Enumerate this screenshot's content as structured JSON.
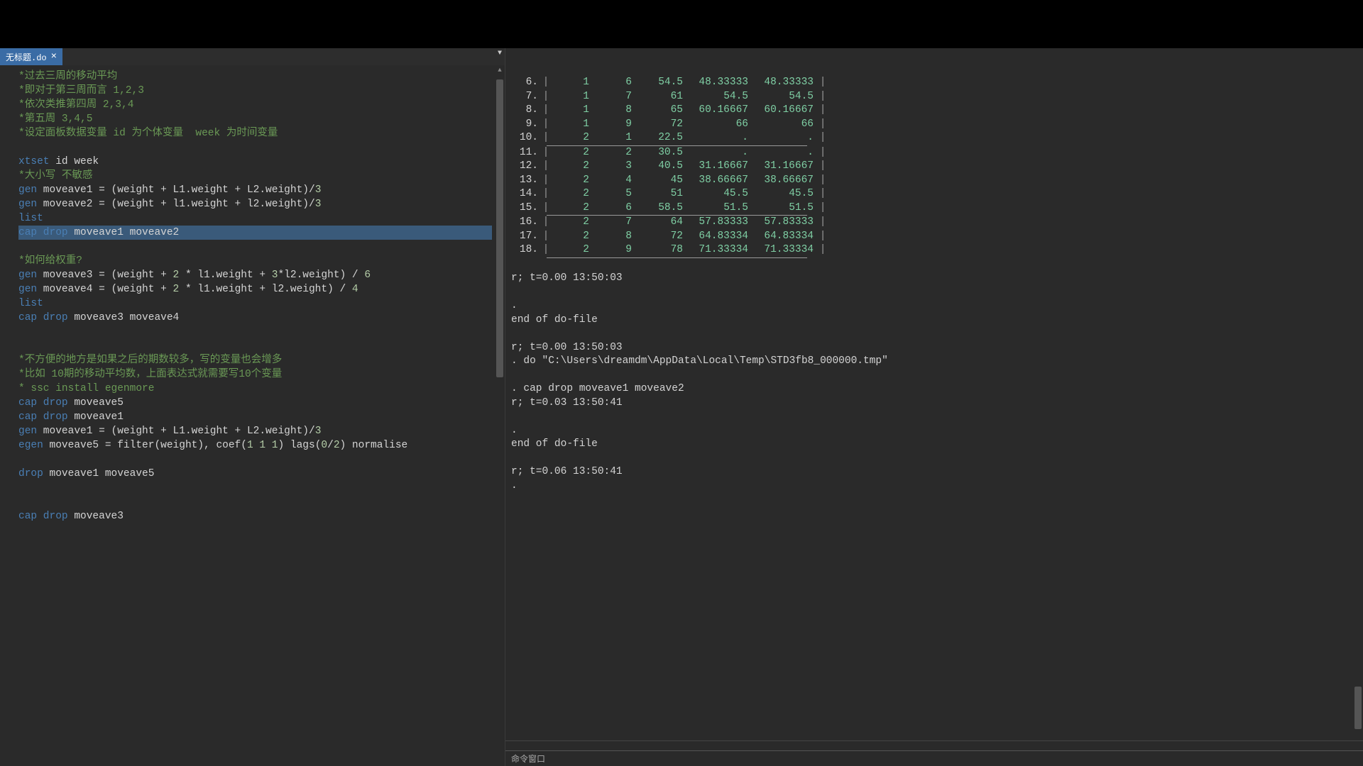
{
  "tab": {
    "name": "无标题.do",
    "close": "×"
  },
  "editor": {
    "lines": [
      {
        "type": "comment",
        "text": "*过去三周的移动平均"
      },
      {
        "type": "comment",
        "text": "*即对于第三周而言 1,2,3"
      },
      {
        "type": "comment",
        "text": "*依次类推第四周 2,3,4"
      },
      {
        "type": "comment",
        "text": "*第五周 3,4,5"
      },
      {
        "type": "comment",
        "text": "*设定面板数据变量 id 为个体变量  week 为时间变量"
      },
      {
        "type": "blank",
        "text": ""
      },
      {
        "type": "code",
        "parts": [
          [
            "k",
            "xtset"
          ],
          [
            "t",
            " id week"
          ]
        ]
      },
      {
        "type": "comment",
        "text": "*大小写 不敏感"
      },
      {
        "type": "code",
        "parts": [
          [
            "k",
            "gen"
          ],
          [
            "t",
            " moveave1 = (weight + L1.weight + L2.weight)/"
          ],
          [
            "n",
            "3"
          ]
        ]
      },
      {
        "type": "code",
        "parts": [
          [
            "k",
            "gen"
          ],
          [
            "t",
            " moveave2 = (weight + l1.weight + l2.weight)/"
          ],
          [
            "n",
            "3"
          ]
        ]
      },
      {
        "type": "code",
        "parts": [
          [
            "k",
            "list"
          ]
        ]
      },
      {
        "type": "hl",
        "parts": [
          [
            "k",
            "cap drop"
          ],
          [
            "t",
            " moveave1 moveave2"
          ]
        ]
      },
      {
        "type": "blank",
        "text": ""
      },
      {
        "type": "comment",
        "text": "*如何给权重?"
      },
      {
        "type": "code",
        "parts": [
          [
            "k",
            "gen"
          ],
          [
            "t",
            " moveave3 = (weight + "
          ],
          [
            "n",
            "2"
          ],
          [
            "t",
            " * l1.weight + "
          ],
          [
            "n",
            "3"
          ],
          [
            "t",
            "*l2.weight) / "
          ],
          [
            "n",
            "6"
          ]
        ]
      },
      {
        "type": "code",
        "parts": [
          [
            "k",
            "gen"
          ],
          [
            "t",
            " moveave4 = (weight + "
          ],
          [
            "n",
            "2"
          ],
          [
            "t",
            " * l1.weight + l2.weight) / "
          ],
          [
            "n",
            "4"
          ]
        ]
      },
      {
        "type": "code",
        "parts": [
          [
            "k",
            "list"
          ]
        ]
      },
      {
        "type": "code",
        "parts": [
          [
            "k",
            "cap drop"
          ],
          [
            "t",
            " moveave3 moveave4"
          ]
        ]
      },
      {
        "type": "blank",
        "text": ""
      },
      {
        "type": "blank",
        "text": ""
      },
      {
        "type": "comment",
        "text": "*不方便的地方是如果之后的期数较多，写的变量也会增多"
      },
      {
        "type": "comment",
        "text": "*比如 10期的移动平均数，上面表达式就需要写10个变量"
      },
      {
        "type": "comment",
        "text": "* ssc install egenmore"
      },
      {
        "type": "code",
        "parts": [
          [
            "k",
            "cap drop"
          ],
          [
            "t",
            " moveave5"
          ]
        ]
      },
      {
        "type": "code",
        "parts": [
          [
            "k",
            "cap drop"
          ],
          [
            "t",
            " moveave1"
          ]
        ]
      },
      {
        "type": "code",
        "parts": [
          [
            "k",
            "gen"
          ],
          [
            "t",
            " moveave1 = (weight + L1.weight + L2.weight)/"
          ],
          [
            "n",
            "3"
          ]
        ]
      },
      {
        "type": "code",
        "parts": [
          [
            "k",
            "egen"
          ],
          [
            "t",
            " moveave5 = filter(weight), coef("
          ],
          [
            "n",
            "1 1 1"
          ],
          [
            "t",
            ") lags("
          ],
          [
            "n",
            "0"
          ],
          [
            "t",
            "/"
          ],
          [
            "n",
            "2"
          ],
          [
            "t",
            ") normalise"
          ]
        ]
      },
      {
        "type": "blank",
        "text": ""
      },
      {
        "type": "code",
        "parts": [
          [
            "k",
            "drop"
          ],
          [
            "t",
            " moveave1 moveave5"
          ]
        ]
      },
      {
        "type": "blank",
        "text": ""
      },
      {
        "type": "blank",
        "text": ""
      },
      {
        "type": "code",
        "parts": [
          [
            "k",
            "cap drop"
          ],
          [
            "t",
            " moveave3"
          ]
        ]
      }
    ]
  },
  "results": {
    "table_rows": [
      {
        "n": "6.",
        "c": [
          "1",
          "6",
          "54.5",
          "48.33333",
          "48.33333"
        ]
      },
      {
        "n": "7.",
        "c": [
          "1",
          "7",
          "61",
          "54.5",
          "54.5"
        ]
      },
      {
        "n": "8.",
        "c": [
          "1",
          "8",
          "65",
          "60.16667",
          "60.16667"
        ]
      },
      {
        "n": "9.",
        "c": [
          "1",
          "9",
          "72",
          "66",
          "66"
        ]
      },
      {
        "n": "10.",
        "c": [
          "2",
          "1",
          "22.5",
          ".",
          "."
        ]
      },
      {
        "hr": true
      },
      {
        "n": "11.",
        "c": [
          "2",
          "2",
          "30.5",
          ".",
          "."
        ]
      },
      {
        "n": "12.",
        "c": [
          "2",
          "3",
          "40.5",
          "31.16667",
          "31.16667"
        ]
      },
      {
        "n": "13.",
        "c": [
          "2",
          "4",
          "45",
          "38.66667",
          "38.66667"
        ]
      },
      {
        "n": "14.",
        "c": [
          "2",
          "5",
          "51",
          "45.5",
          "45.5"
        ]
      },
      {
        "n": "15.",
        "c": [
          "2",
          "6",
          "58.5",
          "51.5",
          "51.5"
        ]
      },
      {
        "hr": true
      },
      {
        "n": "16.",
        "c": [
          "2",
          "7",
          "64",
          "57.83333",
          "57.83333"
        ]
      },
      {
        "n": "17.",
        "c": [
          "2",
          "8",
          "72",
          "64.83334",
          "64.83334"
        ]
      },
      {
        "n": "18.",
        "c": [
          "2",
          "9",
          "78",
          "71.33334",
          "71.33334"
        ]
      },
      {
        "bottom": true
      }
    ],
    "log": [
      "",
      "r; t=0.00 13:50:03",
      "",
      ".",
      "end of do-file",
      "",
      "r; t=0.00 13:50:03",
      ". do \"C:\\Users\\dreamdm\\AppData\\Local\\Temp\\STD3fb8_000000.tmp\"",
      "",
      ". cap drop moveave1 moveave2",
      "r; t=0.03 13:50:41",
      "",
      ".",
      "end of do-file",
      "",
      "r; t=0.06 13:50:41",
      "."
    ]
  },
  "cmdbar": {
    "label": "命令窗口"
  }
}
